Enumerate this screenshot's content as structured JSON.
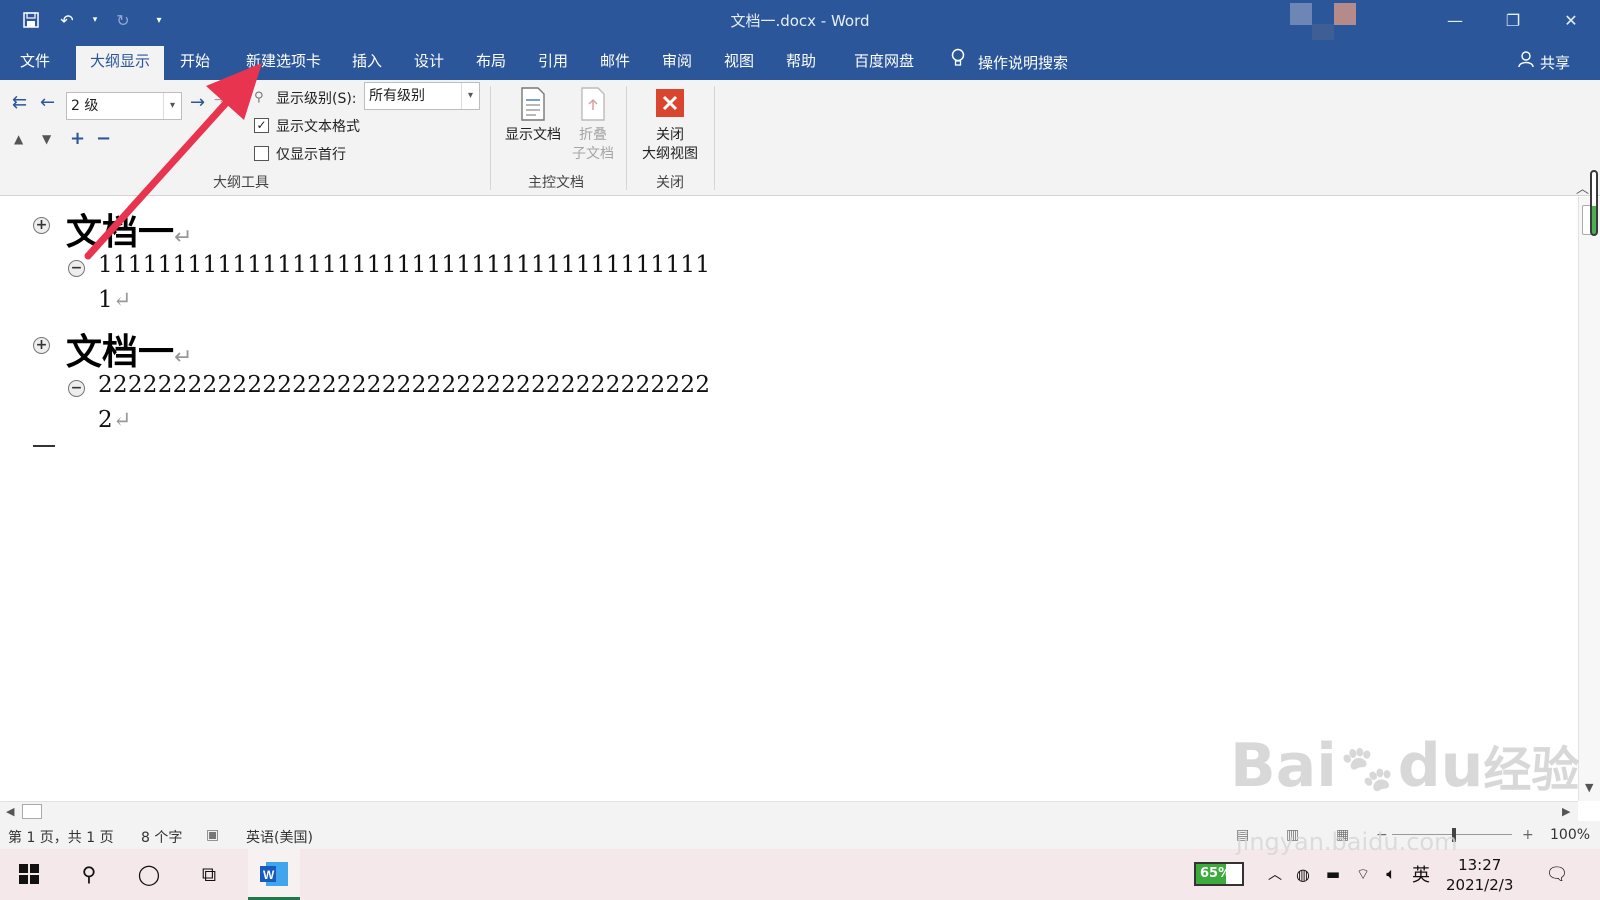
{
  "window": {
    "title": "文档一.docx  -  Word"
  },
  "ribbon_tabs": [
    {
      "label": "文件"
    },
    {
      "label": "大纲显示"
    },
    {
      "label": "开始"
    },
    {
      "label": "新建选项卡"
    },
    {
      "label": "插入"
    },
    {
      "label": "设计"
    },
    {
      "label": "布局"
    },
    {
      "label": "引用"
    },
    {
      "label": "邮件"
    },
    {
      "label": "审阅"
    },
    {
      "label": "视图"
    },
    {
      "label": "帮助"
    },
    {
      "label": "百度网盘"
    }
  ],
  "tell_me": "操作说明搜索",
  "share_label": "共享",
  "outline_tools": {
    "level_value": "2 级",
    "show_level_label": "显示级别(S):",
    "show_level_value": "所有级别",
    "show_text_format_label": "显示文本格式",
    "show_text_format_checked": true,
    "show_first_line_label": "仅显示首行",
    "show_first_line_checked": false,
    "group_label": "大纲工具"
  },
  "master_document": {
    "show_document_label": "显示文档",
    "collapse_subdocs_label_1": "折叠",
    "collapse_subdocs_label_2": "子文档",
    "group_label": "主控文档"
  },
  "close_group": {
    "close_outline_label_1": "关闭",
    "close_outline_label_2": "大纲视图",
    "group_label": "关闭"
  },
  "document": {
    "sections": [
      {
        "heading": "文档一",
        "body_line1": "11111111111111111111111111111111111111111",
        "body_line2": "1"
      },
      {
        "heading": "文档一",
        "body_line1": "22222222222222222222222222222222222222222",
        "body_line2": "2"
      }
    ],
    "para_mark": "↵"
  },
  "status": {
    "page": "第 1 页，共 1 页",
    "words": "8 个字",
    "language": "英语(美国)",
    "zoom": "100%"
  },
  "taskbar": {
    "battery": "65%",
    "battery_level": 0.65,
    "ime": "英",
    "time": "13:27",
    "date": "2021/2/3"
  },
  "watermark": {
    "text1": "Bai",
    "text2": "du",
    "text3": "经验",
    "url": "jingyan.baidu.com"
  },
  "colors": {
    "brand": "#2b579a",
    "annotation_arrow": "#e8344e",
    "close_icon": "#d9452e"
  }
}
